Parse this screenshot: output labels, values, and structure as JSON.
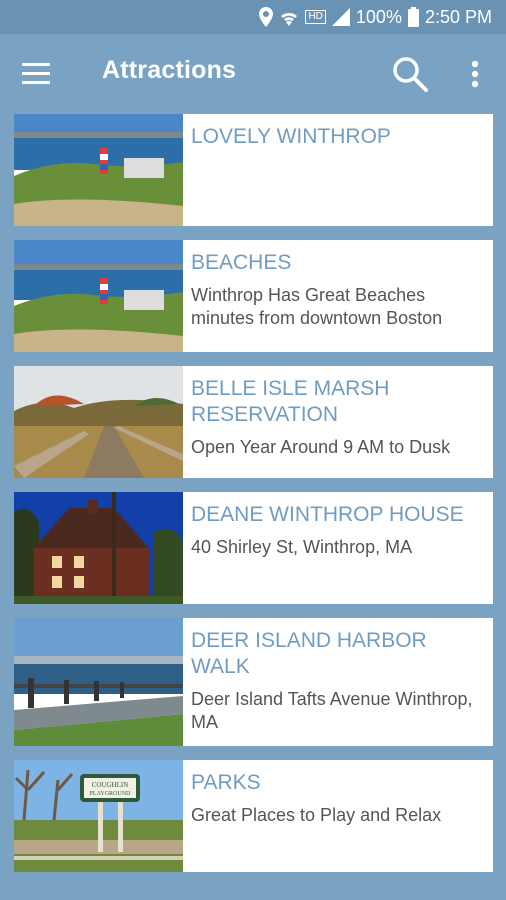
{
  "status": {
    "battery": "100%",
    "time": "2:50 PM",
    "network_label": "HD"
  },
  "app_bar": {
    "title": "Attractions",
    "icons": [
      "menu-icon",
      "search-icon",
      "more-vert-icon"
    ]
  },
  "items": [
    {
      "title": "LOVELY WINTHROP",
      "subtitle": "",
      "image": "harbor-lighthouse-photo"
    },
    {
      "title": "BEACHES",
      "subtitle": "Winthrop Has Great Beaches minutes from downtown Boston",
      "image": "harbor-lighthouse-photo"
    },
    {
      "title": "BELLE ISLE MARSH RESERVATION",
      "subtitle": "Open Year Around 9 AM to Dusk",
      "image": "marsh-boardwalk-photo"
    },
    {
      "title": "DEANE WINTHROP HOUSE",
      "subtitle": "40 Shirley St, Winthrop, MA",
      "image": "colonial-house-photo"
    },
    {
      "title": "DEER ISLAND HARBOR WALK",
      "subtitle": "Deer Island Tafts Avenue Winthrop, MA",
      "image": "harbor-walk-photo"
    },
    {
      "title": "PARKS",
      "subtitle": "Great Places to Play and Relax",
      "image": "playground-sign-photo",
      "sign_text": [
        "COUGHLIN",
        "PLAYGROUND"
      ]
    }
  ]
}
